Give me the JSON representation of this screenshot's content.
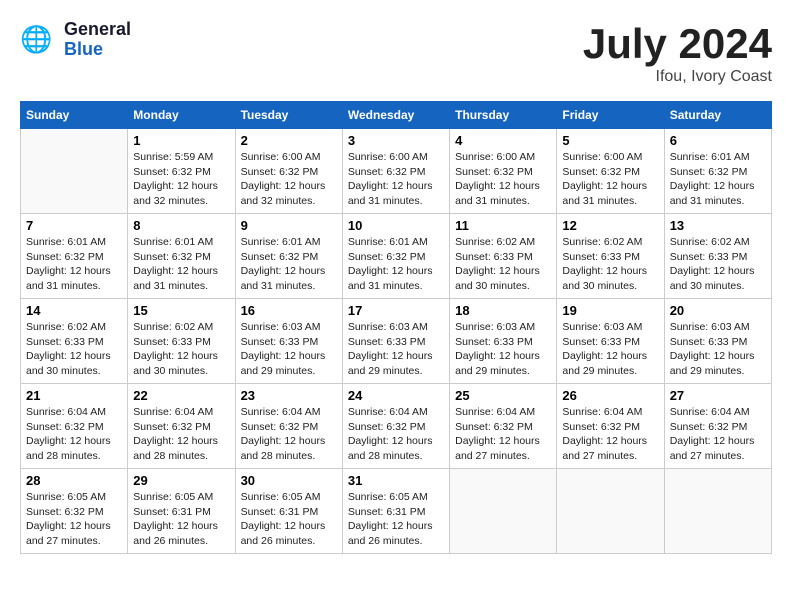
{
  "header": {
    "logo_general": "General",
    "logo_blue": "Blue",
    "month_year": "July 2024",
    "location": "Ifou, Ivory Coast"
  },
  "calendar": {
    "days_of_week": [
      "Sunday",
      "Monday",
      "Tuesday",
      "Wednesday",
      "Thursday",
      "Friday",
      "Saturday"
    ],
    "weeks": [
      [
        {
          "day": "",
          "info": ""
        },
        {
          "day": "1",
          "info": "Sunrise: 5:59 AM\nSunset: 6:32 PM\nDaylight: 12 hours\nand 32 minutes."
        },
        {
          "day": "2",
          "info": "Sunrise: 6:00 AM\nSunset: 6:32 PM\nDaylight: 12 hours\nand 32 minutes."
        },
        {
          "day": "3",
          "info": "Sunrise: 6:00 AM\nSunset: 6:32 PM\nDaylight: 12 hours\nand 31 minutes."
        },
        {
          "day": "4",
          "info": "Sunrise: 6:00 AM\nSunset: 6:32 PM\nDaylight: 12 hours\nand 31 minutes."
        },
        {
          "day": "5",
          "info": "Sunrise: 6:00 AM\nSunset: 6:32 PM\nDaylight: 12 hours\nand 31 minutes."
        },
        {
          "day": "6",
          "info": "Sunrise: 6:01 AM\nSunset: 6:32 PM\nDaylight: 12 hours\nand 31 minutes."
        }
      ],
      [
        {
          "day": "7",
          "info": "Sunrise: 6:01 AM\nSunset: 6:32 PM\nDaylight: 12 hours\nand 31 minutes."
        },
        {
          "day": "8",
          "info": "Sunrise: 6:01 AM\nSunset: 6:32 PM\nDaylight: 12 hours\nand 31 minutes."
        },
        {
          "day": "9",
          "info": "Sunrise: 6:01 AM\nSunset: 6:32 PM\nDaylight: 12 hours\nand 31 minutes."
        },
        {
          "day": "10",
          "info": "Sunrise: 6:01 AM\nSunset: 6:32 PM\nDaylight: 12 hours\nand 31 minutes."
        },
        {
          "day": "11",
          "info": "Sunrise: 6:02 AM\nSunset: 6:33 PM\nDaylight: 12 hours\nand 30 minutes."
        },
        {
          "day": "12",
          "info": "Sunrise: 6:02 AM\nSunset: 6:33 PM\nDaylight: 12 hours\nand 30 minutes."
        },
        {
          "day": "13",
          "info": "Sunrise: 6:02 AM\nSunset: 6:33 PM\nDaylight: 12 hours\nand 30 minutes."
        }
      ],
      [
        {
          "day": "14",
          "info": "Sunrise: 6:02 AM\nSunset: 6:33 PM\nDaylight: 12 hours\nand 30 minutes."
        },
        {
          "day": "15",
          "info": "Sunrise: 6:02 AM\nSunset: 6:33 PM\nDaylight: 12 hours\nand 30 minutes."
        },
        {
          "day": "16",
          "info": "Sunrise: 6:03 AM\nSunset: 6:33 PM\nDaylight: 12 hours\nand 29 minutes."
        },
        {
          "day": "17",
          "info": "Sunrise: 6:03 AM\nSunset: 6:33 PM\nDaylight: 12 hours\nand 29 minutes."
        },
        {
          "day": "18",
          "info": "Sunrise: 6:03 AM\nSunset: 6:33 PM\nDaylight: 12 hours\nand 29 minutes."
        },
        {
          "day": "19",
          "info": "Sunrise: 6:03 AM\nSunset: 6:33 PM\nDaylight: 12 hours\nand 29 minutes."
        },
        {
          "day": "20",
          "info": "Sunrise: 6:03 AM\nSunset: 6:33 PM\nDaylight: 12 hours\nand 29 minutes."
        }
      ],
      [
        {
          "day": "21",
          "info": "Sunrise: 6:04 AM\nSunset: 6:32 PM\nDaylight: 12 hours\nand 28 minutes."
        },
        {
          "day": "22",
          "info": "Sunrise: 6:04 AM\nSunset: 6:32 PM\nDaylight: 12 hours\nand 28 minutes."
        },
        {
          "day": "23",
          "info": "Sunrise: 6:04 AM\nSunset: 6:32 PM\nDaylight: 12 hours\nand 28 minutes."
        },
        {
          "day": "24",
          "info": "Sunrise: 6:04 AM\nSunset: 6:32 PM\nDaylight: 12 hours\nand 28 minutes."
        },
        {
          "day": "25",
          "info": "Sunrise: 6:04 AM\nSunset: 6:32 PM\nDaylight: 12 hours\nand 27 minutes."
        },
        {
          "day": "26",
          "info": "Sunrise: 6:04 AM\nSunset: 6:32 PM\nDaylight: 12 hours\nand 27 minutes."
        },
        {
          "day": "27",
          "info": "Sunrise: 6:04 AM\nSunset: 6:32 PM\nDaylight: 12 hours\nand 27 minutes."
        }
      ],
      [
        {
          "day": "28",
          "info": "Sunrise: 6:05 AM\nSunset: 6:32 PM\nDaylight: 12 hours\nand 27 minutes."
        },
        {
          "day": "29",
          "info": "Sunrise: 6:05 AM\nSunset: 6:31 PM\nDaylight: 12 hours\nand 26 minutes."
        },
        {
          "day": "30",
          "info": "Sunrise: 6:05 AM\nSunset: 6:31 PM\nDaylight: 12 hours\nand 26 minutes."
        },
        {
          "day": "31",
          "info": "Sunrise: 6:05 AM\nSunset: 6:31 PM\nDaylight: 12 hours\nand 26 minutes."
        },
        {
          "day": "",
          "info": ""
        },
        {
          "day": "",
          "info": ""
        },
        {
          "day": "",
          "info": ""
        }
      ]
    ]
  }
}
